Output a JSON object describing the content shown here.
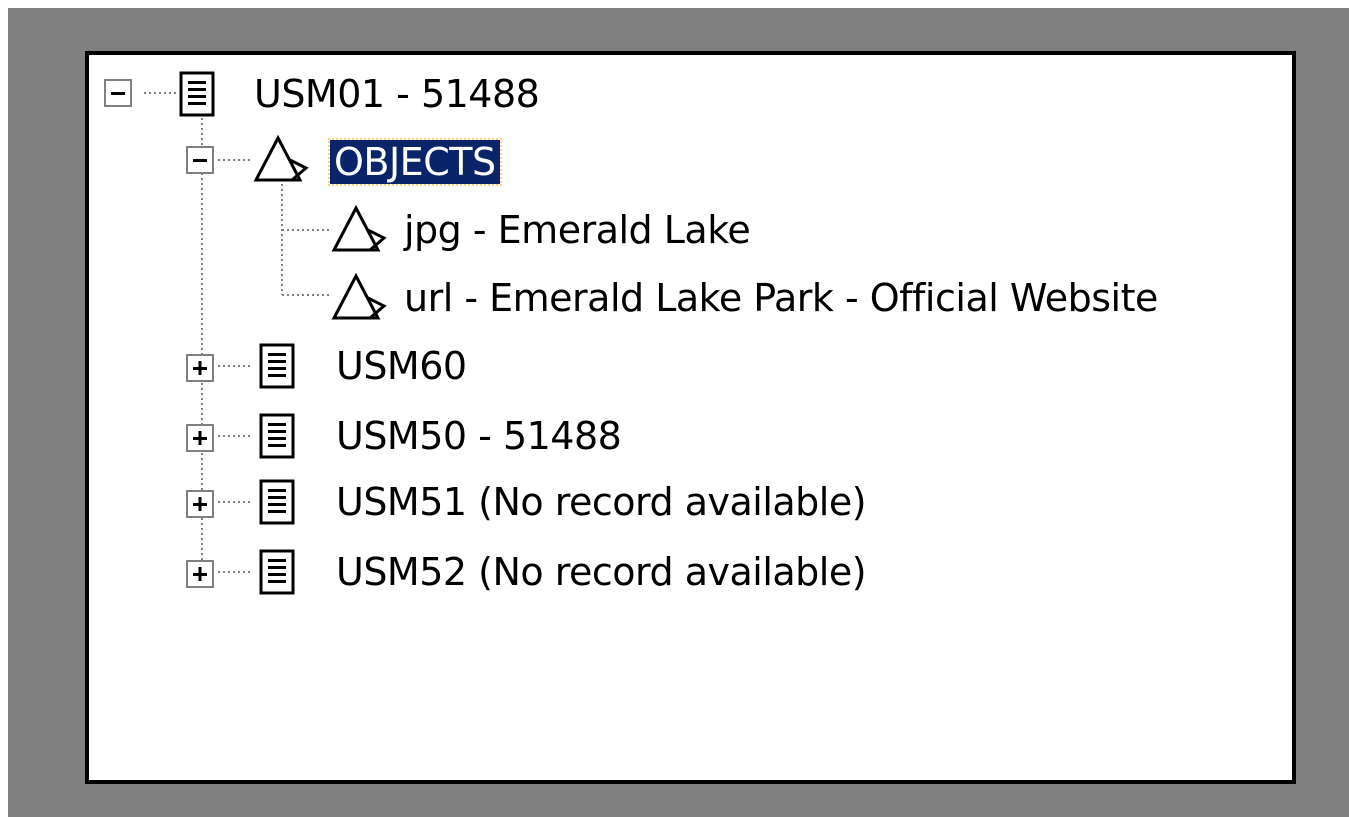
{
  "tree": {
    "root": {
      "label": "USM01 - 51488",
      "expander": "minus",
      "icon": "record-icon",
      "children": {
        "objects": {
          "label": "OBJECTS",
          "expander": "minus",
          "icon": "triangle-object-icon",
          "selected": true,
          "items": [
            {
              "label": "jpg - Emerald Lake",
              "icon": "triangle-object-icon"
            },
            {
              "label": "url - Emerald Lake Park - Official Website",
              "icon": "triangle-object-icon"
            }
          ]
        },
        "records": [
          {
            "label": "USM60",
            "expander": "plus",
            "icon": "record-icon"
          },
          {
            "label": "USM50 - 51488",
            "expander": "plus",
            "icon": "record-icon"
          },
          {
            "label": "USM51 (No record available)",
            "expander": "plus",
            "icon": "record-icon"
          },
          {
            "label": "USM52 (No record available)",
            "expander": "plus",
            "icon": "record-icon"
          }
        ]
      }
    }
  },
  "colors": {
    "selection_bg": "#0a246a",
    "selection_fg": "#ffffff",
    "focus_outline": "#ffd27a",
    "frame_gray": "#808080",
    "border": "#000000"
  }
}
